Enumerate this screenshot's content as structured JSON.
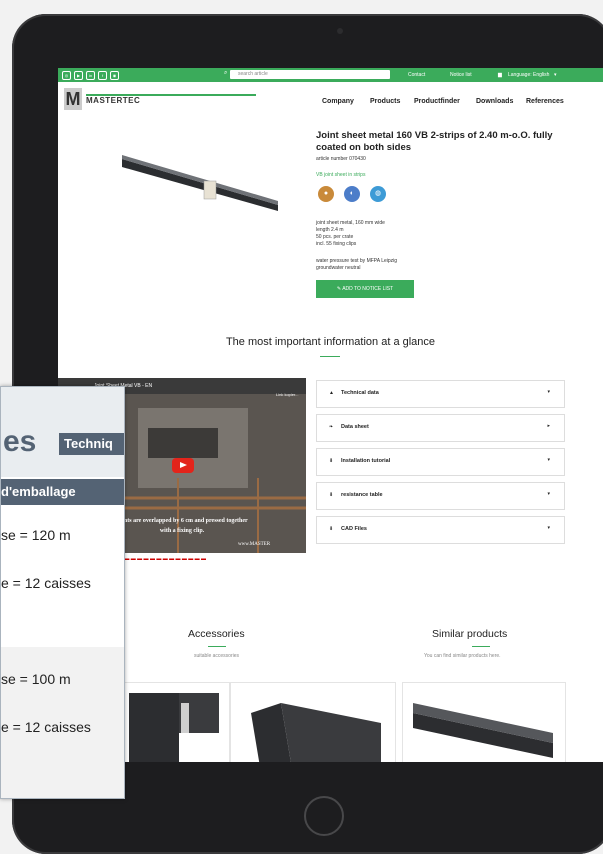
{
  "topbar": {
    "social_icons": [
      "instagram-icon",
      "youtube-icon",
      "linkedin-icon",
      "facebook-icon",
      "camera-icon"
    ],
    "search_placeholder": "search article",
    "contact": "Contact",
    "notice_list": "Notice list",
    "language": "Language: English"
  },
  "navbar": {
    "logo_mark": "M",
    "logo_text": "MASTERTEC",
    "items": [
      "Company",
      "Products",
      "Productfinder",
      "Downloads",
      "References"
    ]
  },
  "product": {
    "title": "Joint sheet metal 160 VB 2-strips of 2.40 m-o.O. fully coated on both sides",
    "article_number": "article number 070430",
    "category": "VB joint sheet in strips",
    "specs": [
      "joint sheet metal, 160 mm wide",
      "length 2.4 m",
      "50 pcs. per crate",
      "incl. 55 fixing clips"
    ],
    "specs2": [
      "water pressure test by MFPA Leipzig",
      "groundwater neutral"
    ],
    "add_button": "ADD TO NOTICE LIST"
  },
  "section": {
    "title": "The most important information at a glance"
  },
  "video": {
    "title": "Joint Sheet Metal VB - EN",
    "link": "Link kopier...",
    "subtitle1": "Joints are overlapped by 6 cm and pressed together",
    "subtitle2": "with a fixing clip.",
    "watermark": "www.MASTER"
  },
  "accordion": [
    {
      "icon": "info-icon",
      "label": "Technical data",
      "arrow": "▾"
    },
    {
      "icon": "leaf-icon",
      "label": "Data sheet",
      "arrow": "▸"
    },
    {
      "icon": "download-icon",
      "label": "Installation tutorial",
      "arrow": "▾"
    },
    {
      "icon": "download-icon",
      "label": "resistance table",
      "arrow": "▾"
    },
    {
      "icon": "download-icon",
      "label": "CAD Files",
      "arrow": "▾"
    }
  ],
  "accessories": {
    "title": "Accessories",
    "subtitle": "suitable accessories"
  },
  "similar": {
    "title": "Similar products",
    "subtitle": "You can find similar products here."
  },
  "overlay": {
    "heading_fragment": "es",
    "tab_fragment": "Techniq",
    "bar": "d'emballage",
    "line1": "se = 120 m",
    "line2": "e = 12 caisses",
    "line3": "se = 100 m",
    "line4": "e = 12 caisses"
  },
  "colors": {
    "accent": "#3bab5b",
    "overlay_blue": "#546374"
  }
}
